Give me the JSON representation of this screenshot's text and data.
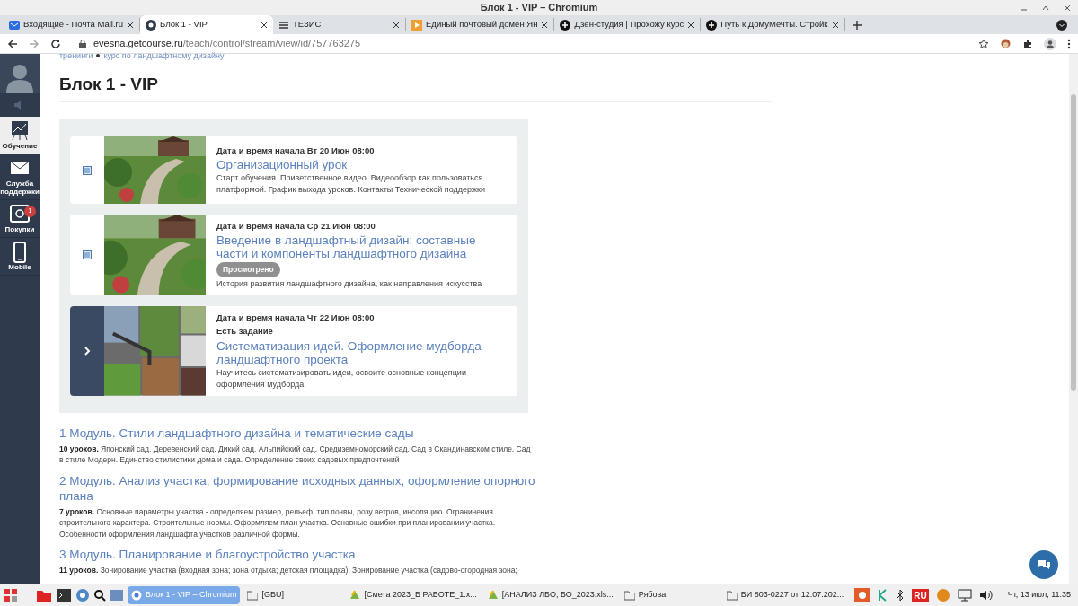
{
  "window": {
    "title": "Блок 1 - VIP – Chromium"
  },
  "tabs": [
    {
      "label": "Входящие - Почта Mail.ru",
      "kind": "mail",
      "selected": false
    },
    {
      "label": "Блок 1 - VIP",
      "kind": "gc",
      "selected": true
    },
    {
      "label": "ТЕЗИС",
      "kind": "menu",
      "selected": false
    },
    {
      "label": "Единый почтовый домен Ян",
      "kind": "play",
      "selected": false
    },
    {
      "label": "Дзен-студия | Прохожу курс",
      "kind": "circle",
      "selected": false
    },
    {
      "label": "Путь к ДомуМечты. Стройк",
      "kind": "circle",
      "selected": false
    }
  ],
  "address": {
    "host": "evesna.getcourse.ru",
    "path": "/teach/control/stream/view/id/757763275"
  },
  "sidebar": {
    "items": [
      {
        "label": "Обучение",
        "kind": "chart",
        "selected": true
      },
      {
        "label": "Служба поддержки",
        "kind": "mail",
        "selected": false
      },
      {
        "label": "Покупки",
        "kind": "safe",
        "selected": false,
        "badge": "1"
      },
      {
        "label": "Mobile",
        "kind": "phone",
        "selected": false
      }
    ]
  },
  "breadcrumbs": [
    "тренинги",
    "курс по ландшафтному дизайну"
  ],
  "page_title": "Блок 1 - VIP",
  "lessons": [
    {
      "kind": "doc",
      "date": "Дата и время начала Вт 20 Июн 08:00",
      "title": "Организационный урок",
      "description": "Старт обучения. Приветственное видео. Видеообзор как пользоваться платформой. График выхода уроков. Контакты Технической поддержки"
    },
    {
      "kind": "doc",
      "date": "Дата и время начала Ср 21 Июн 08:00",
      "title": "Введение в ландшафтный дизайн: составные части и компоненты ландшафтного дизайна",
      "status": "Просмотрено",
      "description": "История развития ландшафтного дизайна, как направления искусства"
    },
    {
      "kind": "arrow",
      "date": "Дата и время начала Чт 22 Июн 08:00",
      "task": "Есть задание",
      "title": "Систематизация идей. Оформление мудборда ландшафтного проекта",
      "description": "Научитесь систематизировать идеи, освоите основные концепции оформления мудборда"
    }
  ],
  "modules": [
    {
      "title": "1 Модуль. Стили ландшафтного дизайна и тематические сады",
      "description": "**10 уроков.** Японский сад. Деревенский сад. Дикий сад. Альпийский сад. Средиземноморский сад. Сад в Скандинавском стиле. Сад в стиле Модерн. Единство стилистики дома и сада. Определение своих садовых предпочтений"
    },
    {
      "title": "2 Модуль. Анализ участка, формирование исходных данных, оформление опорного плана",
      "description": "**7 уроков.** Основные параметры участка - определяем размер, рельеф, тип почвы, розу ветров, инсоляцию. Ограничения строительного характера. Строительные нормы. Оформляем план участка. Основные ошибки при планировании участка. Особенности оформления ландшафта участков различной формы."
    },
    {
      "title": "3 Модуль. Планирование и благоустройство участка",
      "description": "**11 уроков.** Зонирование участка (входная зона; зона отдыха; детская площадка). Зонирование участка (садово-огородная зона;"
    }
  ],
  "taskbar": {
    "items": [
      {
        "label": "Блок 1 - VIP – Chromium",
        "kind": "chrome",
        "selected": true
      },
      {
        "label": "[GBU]",
        "kind": "folder",
        "selected": false
      },
      {
        "label": "[Смета 2023_В РАБОТЕ_1.x...",
        "kind": "sheet",
        "selected": false
      },
      {
        "label": "[АНАЛИЗ ЛБО, БО_2023.xls...",
        "kind": "sheet",
        "selected": false
      },
      {
        "label": "Рябова",
        "kind": "folder",
        "selected": false
      },
      {
        "label": "ВИ 803-0227 от 12.07.202...",
        "kind": "folder",
        "selected": false
      }
    ],
    "language": "RU",
    "clock": "Чт, 13 июл, 11:35"
  }
}
